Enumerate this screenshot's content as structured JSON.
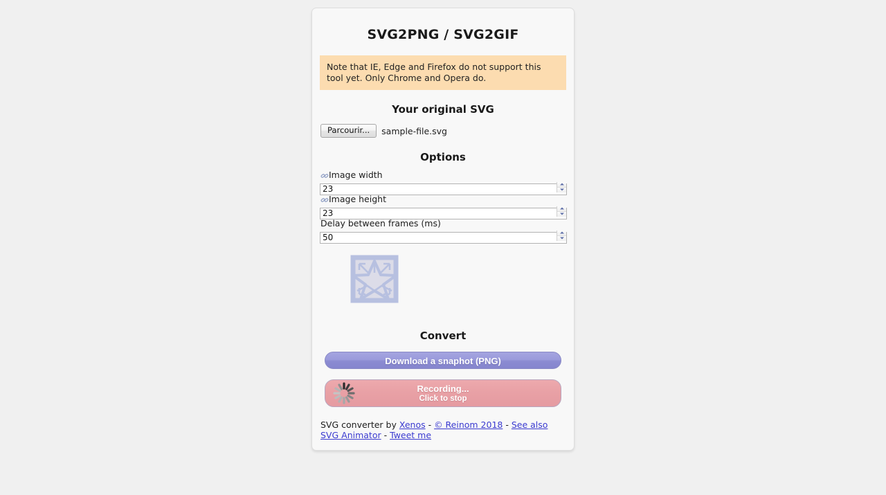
{
  "app": {
    "title": "SVG2PNG / SVG2GIF",
    "note": "Note that IE, Edge and Firefox do not support this tool yet. Only Chrome and Opera do."
  },
  "source": {
    "heading": "Your original SVG",
    "browse_label": "Parcourir...",
    "file_name": "sample-file.svg"
  },
  "options": {
    "heading": "Options",
    "fields": [
      {
        "label": "Image width",
        "value": "23",
        "icon": "chain-link-icon",
        "linked": true
      },
      {
        "label": "Image height",
        "value": "23",
        "icon": "chain-link-icon",
        "linked": true
      },
      {
        "label": "Delay between frames (ms)",
        "value": "50",
        "icon": "",
        "linked": false
      }
    ]
  },
  "preview": {
    "alt": "star-in-square-svg-preview",
    "stroke_color": "#b7c0e0",
    "fill_color": "#dcdce8"
  },
  "convert": {
    "heading": "Convert",
    "download_label": "Download a snaphot (PNG)",
    "record_label": "Recording...",
    "record_sublabel": "Click to stop",
    "download_color": "#9a9adb",
    "record_color": "#e8a0a5"
  },
  "footer": {
    "prefix": "SVG converter by ",
    "author": "Xenos",
    "sep1": " - ",
    "copyright": "© Reinom 2018",
    "sep2": " - ",
    "animator": "See also SVG Animator",
    "sep3": " - ",
    "tweet": "Tweet me",
    "link_color": "#3a3ad0"
  }
}
